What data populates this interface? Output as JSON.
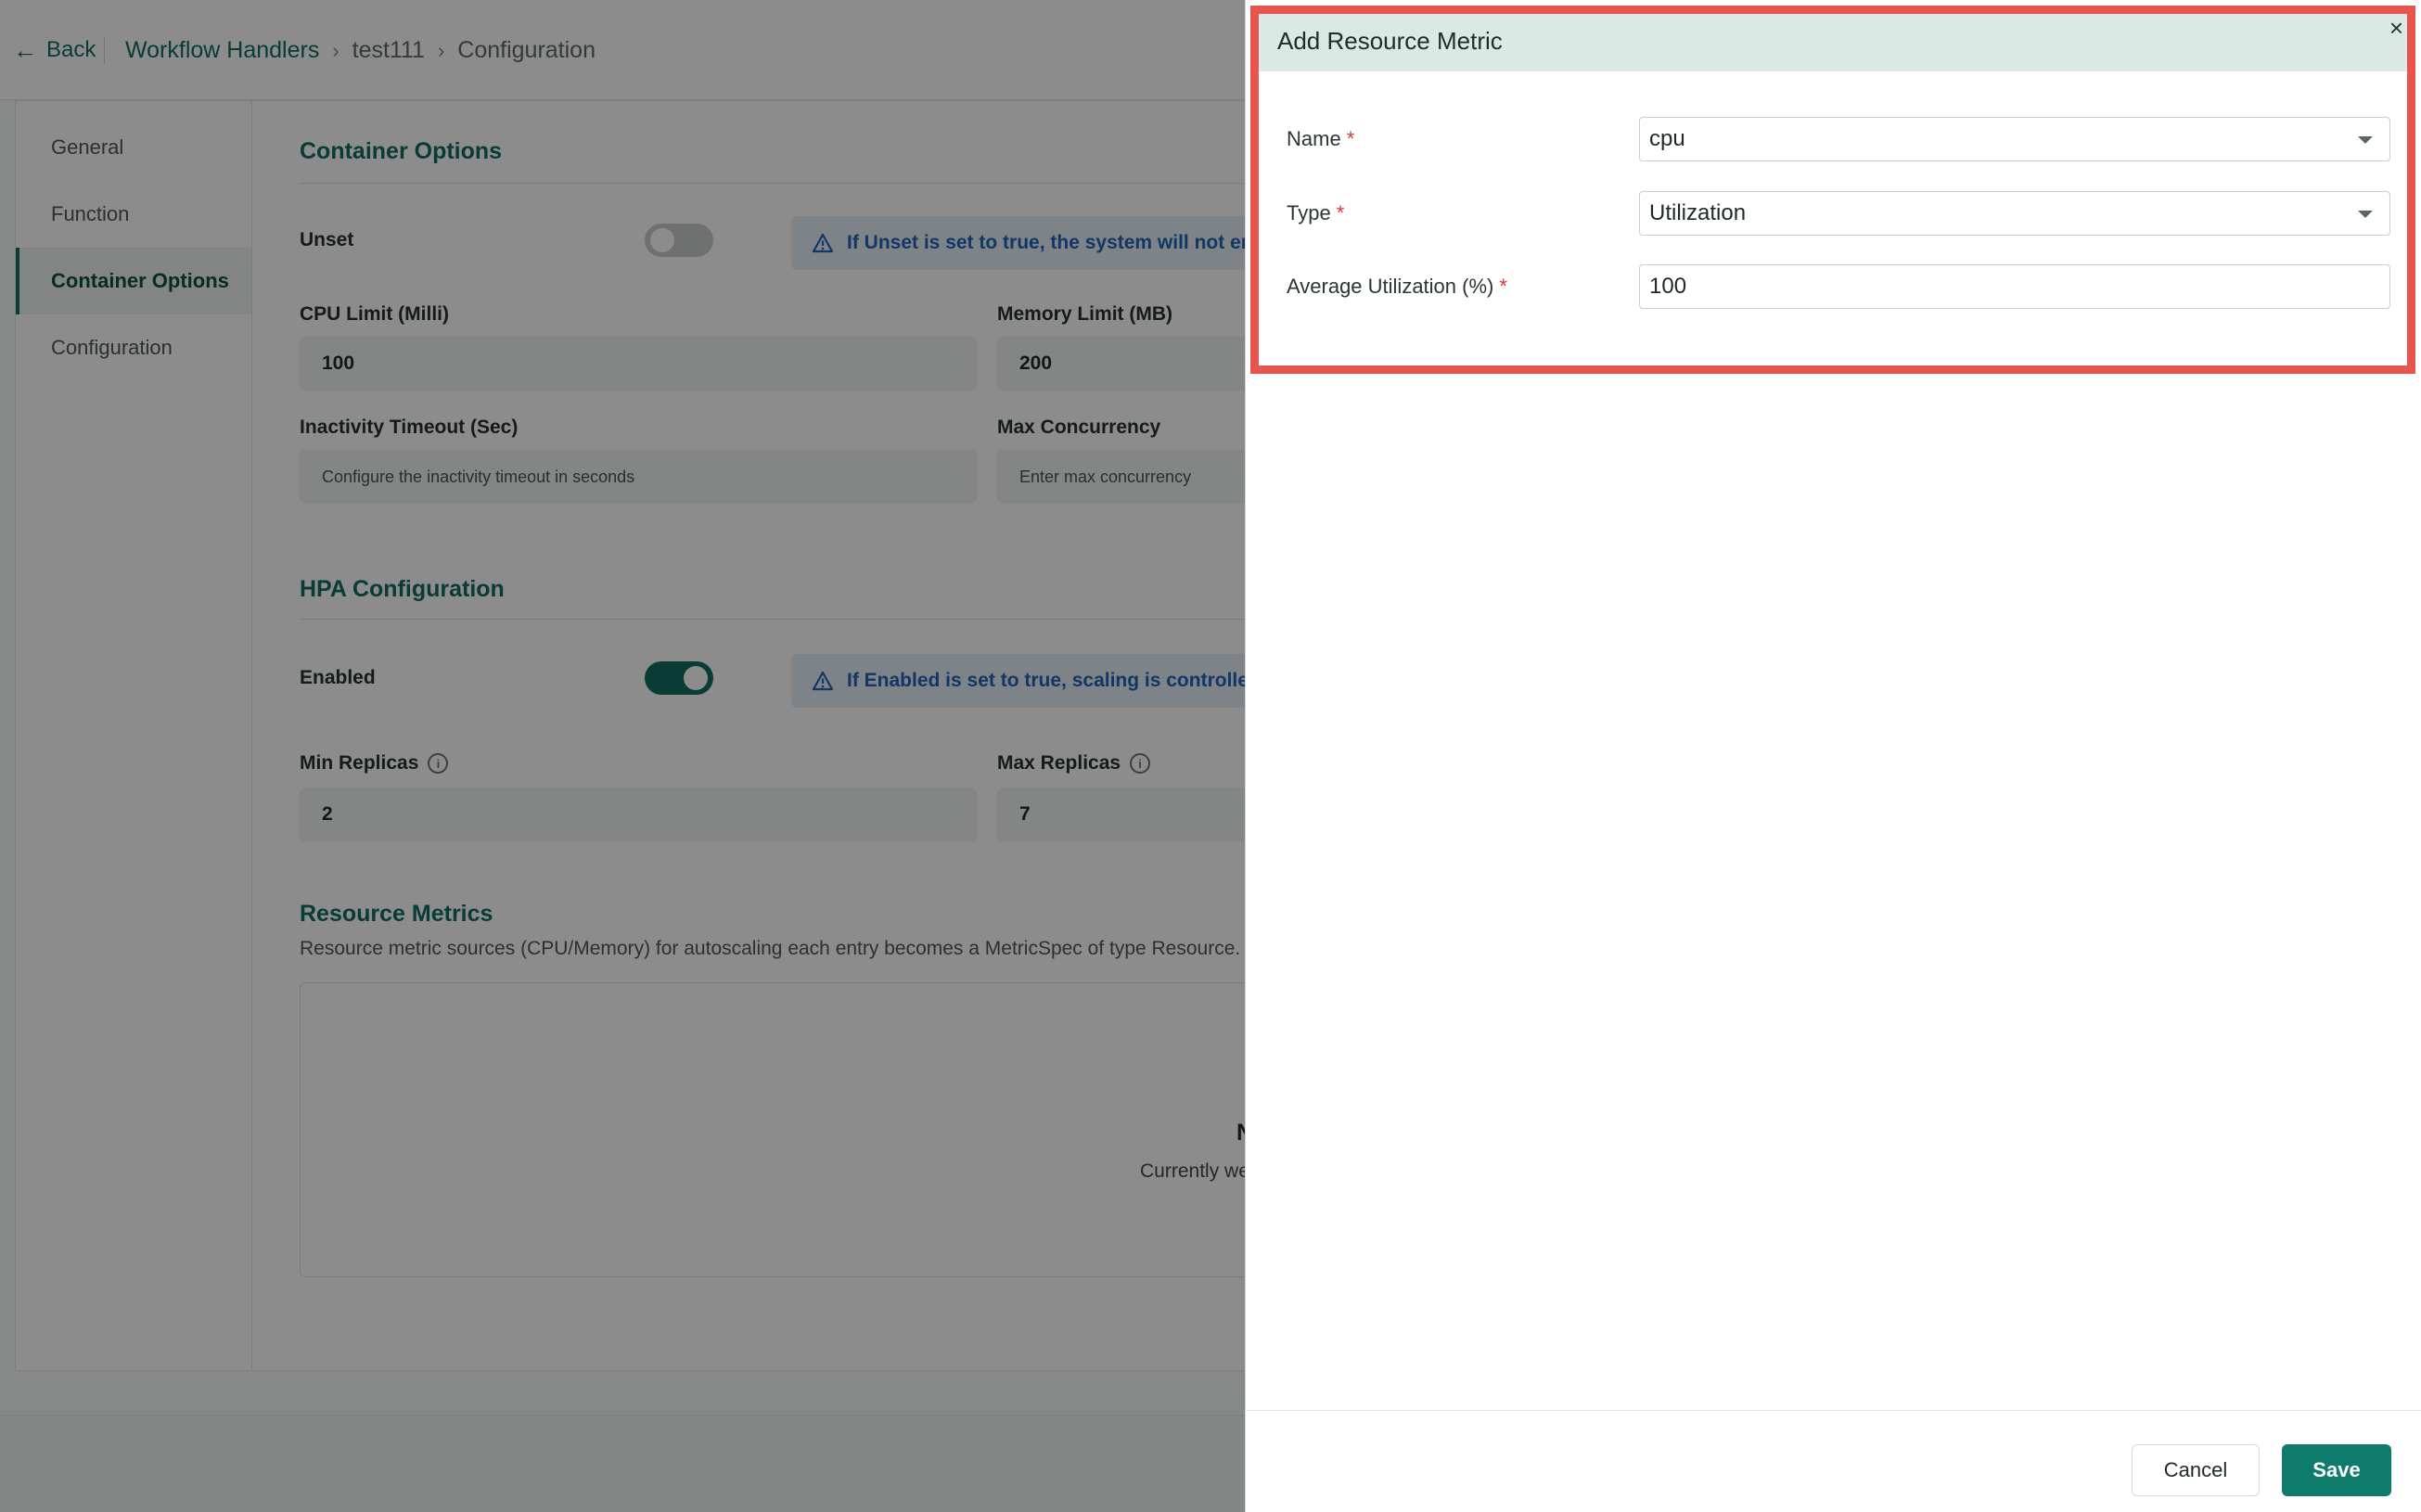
{
  "header": {
    "back_label": "Back",
    "breadcrumb": [
      "Workflow Handlers",
      "test111",
      "Configuration"
    ],
    "separator": "›"
  },
  "sidebar": {
    "items": [
      {
        "label": "General"
      },
      {
        "label": "Function"
      },
      {
        "label": "Container Options"
      },
      {
        "label": "Configuration"
      }
    ],
    "active": "Container Options"
  },
  "container_options": {
    "title": "Container Options",
    "unset": {
      "label": "Unset",
      "value": false,
      "alert": "If Unset is set to true, the system will not emit C"
    },
    "cpu_limit": {
      "label": "CPU Limit (Milli)",
      "value": "100"
    },
    "memory_limit": {
      "label": "Memory Limit (MB)",
      "value": "200"
    },
    "inactivity_timeout": {
      "label": "Inactivity Timeout (Sec)",
      "placeholder": "Configure the inactivity timeout in seconds"
    },
    "max_concurrency": {
      "label": "Max Concurrency",
      "placeholder": "Enter max concurrency"
    }
  },
  "hpa": {
    "title": "HPA Configuration",
    "enabled": {
      "label": "Enabled",
      "value": true,
      "alert": "If Enabled is set to true, scaling is controlled by"
    },
    "min_replicas": {
      "label": "Min Replicas",
      "value": "2"
    },
    "max_replicas": {
      "label": "Max Replicas",
      "value": "7"
    }
  },
  "resource_metrics": {
    "title": "Resource Metrics",
    "description": "Resource metric sources (CPU/Memory) for autoscaling each entry becomes a MetricSpec of type Resource.",
    "empty_title": "N",
    "empty_subtitle": "Currently we c"
  },
  "modal": {
    "title": "Add Resource Metric",
    "close_glyph": "×",
    "required_mark": "*",
    "name": {
      "label": "Name",
      "value": "cpu"
    },
    "type": {
      "label": "Type",
      "value": "Utilization"
    },
    "avg_utilization": {
      "label": "Average Utilization (%)",
      "value": "100"
    }
  },
  "footer": {
    "cancel_label": "Cancel",
    "save_label": "Save"
  },
  "colors": {
    "accent": "#0f6e60",
    "highlight_border": "#e8554e",
    "required": "#e0323b",
    "alert_text": "#2163b8"
  }
}
